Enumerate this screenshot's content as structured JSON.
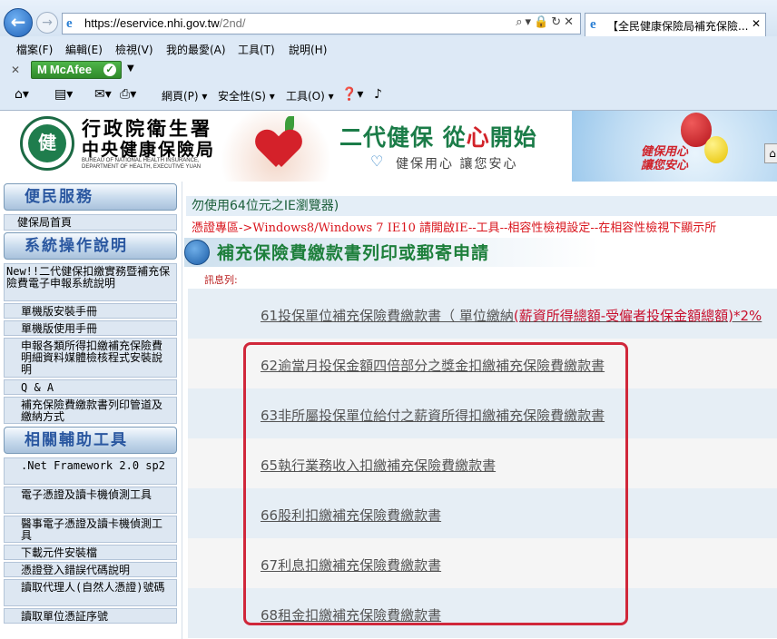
{
  "browser": {
    "url_domain": "https://eservice.nhi.gov.tw",
    "url_path": "/2nd/",
    "tab_title": "【全民健康保險局補充保險...",
    "menu": [
      "檔案(F)",
      "編輯(E)",
      "檢視(V)",
      "我的最愛(A)",
      "工具(T)",
      "說明(H)"
    ],
    "mcafee_label": "McAfee",
    "command_bar": {
      "page": "網頁(P)",
      "safety": "安全性(S)",
      "tools": "工具(O)"
    }
  },
  "banner": {
    "org_line1": "行政院衛生署",
    "org_line2": "中央健康保險局",
    "org_en_line1": "BUREAU OF NATIONAL HEALTH INSURANCE,",
    "org_en_line2": "DEPARTMENT OF HEALTH, EXECUTIVE YUAN",
    "slogan_a": "二代健保 從",
    "slogan_heart": "心",
    "slogan_b": "開始",
    "slogan_sub": "健保用心 讓您安心",
    "sky_text_1": "健保用心",
    "sky_text_2": "讓您安心"
  },
  "sidebar": {
    "sections": [
      {
        "title": "便民服務",
        "items": [
          "健保局首頁"
        ]
      },
      {
        "title": "系統操作說明",
        "items": [
          "New!!二代健保扣繳實務暨補充保險費電子申報系統說明",
          "單機版安裝手冊",
          "單機版使用手冊",
          "申報各類所得扣繳補充保險費明細資料媒體檢核程式安裝說明",
          "Q & A",
          "補充保險費繳款書列印管道及繳納方式"
        ]
      },
      {
        "title": "相關輔助工具",
        "items": [
          ".Net Framework 2.0 sp2",
          "電子憑證及讀卡機偵測工具",
          "醫事電子憑證及讀卡機偵測工具",
          "下載元件安裝檔",
          "憑證登入錯誤代碼說明",
          "讀取代理人(自然人憑證)號碼",
          "讀取單位憑証序號"
        ]
      }
    ]
  },
  "main": {
    "notice1": "勿使用64位元之IE瀏覽器)",
    "notice2": "憑證專區->Windows8/Windows 7 IE10 請開啟IE--工具--相容性檢視設定--在相容性檢視下顯示所",
    "page_title": "補充保險費繳款書列印或郵寄申請",
    "msg_label": "訊息列:",
    "links": [
      {
        "text": "61投保單位補充保險費繳款書（ 單位繳納",
        "red": "(薪資所得總額-受僱者投保金額總額)*2%"
      },
      {
        "text": "62逾當月投保金額四倍部分之獎金扣繳補充保險費繳款書",
        "red": ""
      },
      {
        "text": "63非所屬投保單位給付之薪資所得扣繳補充保險費繳款書",
        "red": ""
      },
      {
        "text": "65執行業務收入扣繳補充保險費繳款書",
        "red": ""
      },
      {
        "text": "66股利扣繳補充保險費繳款書",
        "red": ""
      },
      {
        "text": "67利息扣繳補充保險費繳款書",
        "red": ""
      },
      {
        "text": "68租金扣繳補充保險費繳款書",
        "red": ""
      }
    ]
  }
}
